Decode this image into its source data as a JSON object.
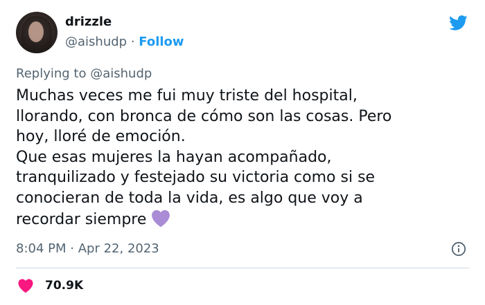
{
  "author": {
    "name": "drizzle",
    "handle": "@aishudp",
    "separator": "·",
    "follow_label": "Follow"
  },
  "reply": {
    "prefix": "Replying to",
    "handle": "@aishudp"
  },
  "tweet": {
    "lines": [
      "Muchas veces me fui muy triste del hospital,",
      "llorando, con bronca de cómo son las cosas. Pero",
      "hoy, lloré de emoción.",
      "Que esas mujeres la hayan acompañado,",
      "tranquilizado y festejado su victoria como si se",
      "conocieran de toda la vida, es algo que voy a",
      "recordar siempre"
    ],
    "emoji": "purple-heart"
  },
  "meta": {
    "time": "8:04 PM",
    "separator": "·",
    "date": "Apr 22, 2023"
  },
  "stats": {
    "likes": "70.9K"
  },
  "colors": {
    "brand": "#1d9bf0",
    "text": "#0f1419",
    "secondary": "#536471",
    "like": "#f91880",
    "heart_emoji": "#a98bd6",
    "divider": "#cfd9de"
  },
  "icons": {
    "logo": "twitter-bird-icon",
    "info": "info-icon",
    "like": "heart-icon"
  }
}
